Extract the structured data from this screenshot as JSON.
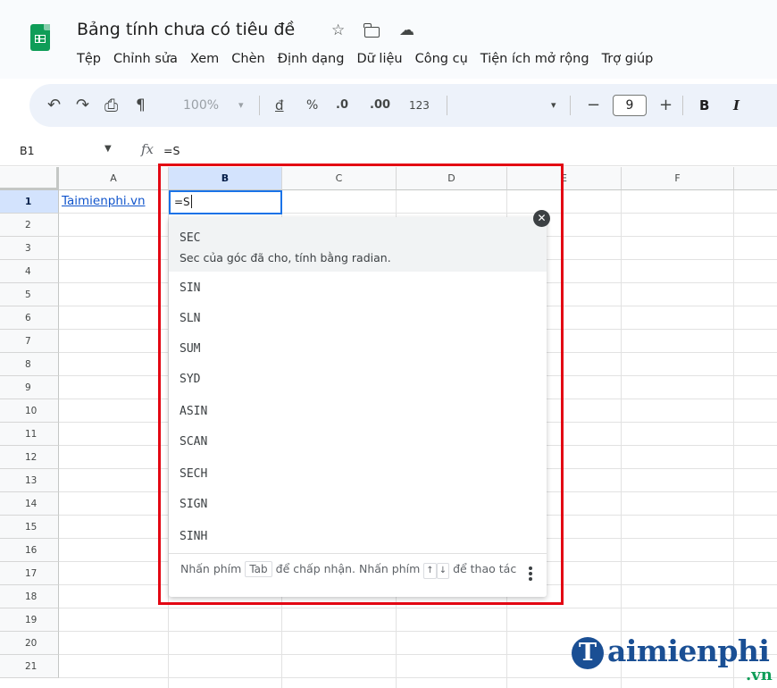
{
  "document": {
    "title": "Bảng tính chưa có tiêu đề"
  },
  "menu": [
    "Tệp",
    "Chỉnh sửa",
    "Xem",
    "Chèn",
    "Định dạng",
    "Dữ liệu",
    "Công cụ",
    "Tiện ích mở rộng",
    "Trợ giúp"
  ],
  "toolbar": {
    "undo": "↶",
    "redo": "↷",
    "print": "⎙",
    "paint_format": "¶",
    "zoom": "100%",
    "zoom_arrow": "▾",
    "currency": "đ",
    "percent": "%",
    "decrease_decimal": ".0",
    "increase_decimal": ".00",
    "number_format": "123",
    "font_arrow": "▾",
    "minus": "−",
    "font_size": "9",
    "plus": "+",
    "bold": "B",
    "italic": "I"
  },
  "formula_bar": {
    "name_box": "B1",
    "fx": "fx",
    "formula": "=S"
  },
  "grid": {
    "columns": [
      "A",
      "B",
      "C",
      "D",
      "E",
      "F"
    ],
    "rows": [
      "1",
      "2",
      "3",
      "4",
      "5",
      "6",
      "7",
      "8",
      "9",
      "10",
      "11",
      "12",
      "13",
      "14",
      "15",
      "16",
      "17",
      "18",
      "19",
      "20",
      "21"
    ],
    "selected_column": "B",
    "selected_row": "1",
    "cells": {
      "A1": "Taimienphi.vn",
      "B1": "=S"
    }
  },
  "autocomplete": {
    "highlighted": "SEC",
    "highlighted_description": "Sec của góc đã cho, tính bằng radian.",
    "items": [
      "SIN",
      "SLN",
      "SUM",
      "SYD",
      "ASIN",
      "SCAN",
      "SECH",
      "SIGN",
      "SINH"
    ],
    "footer": {
      "part1": "Nhấn phím",
      "key_tab": "Tab",
      "part2": "để chấp nhận. Nhấn phím",
      "key_up": "↑",
      "key_down": "↓",
      "part3": "để thao tác"
    }
  },
  "watermark": {
    "initial": "T",
    "brand": "aimienphi",
    "suffix": ".vn"
  },
  "colors": {
    "highlight_border": "#e30613",
    "selection_blue": "#1a73e8",
    "link": "#1155cc",
    "sheets_green": "#0f9d58"
  }
}
